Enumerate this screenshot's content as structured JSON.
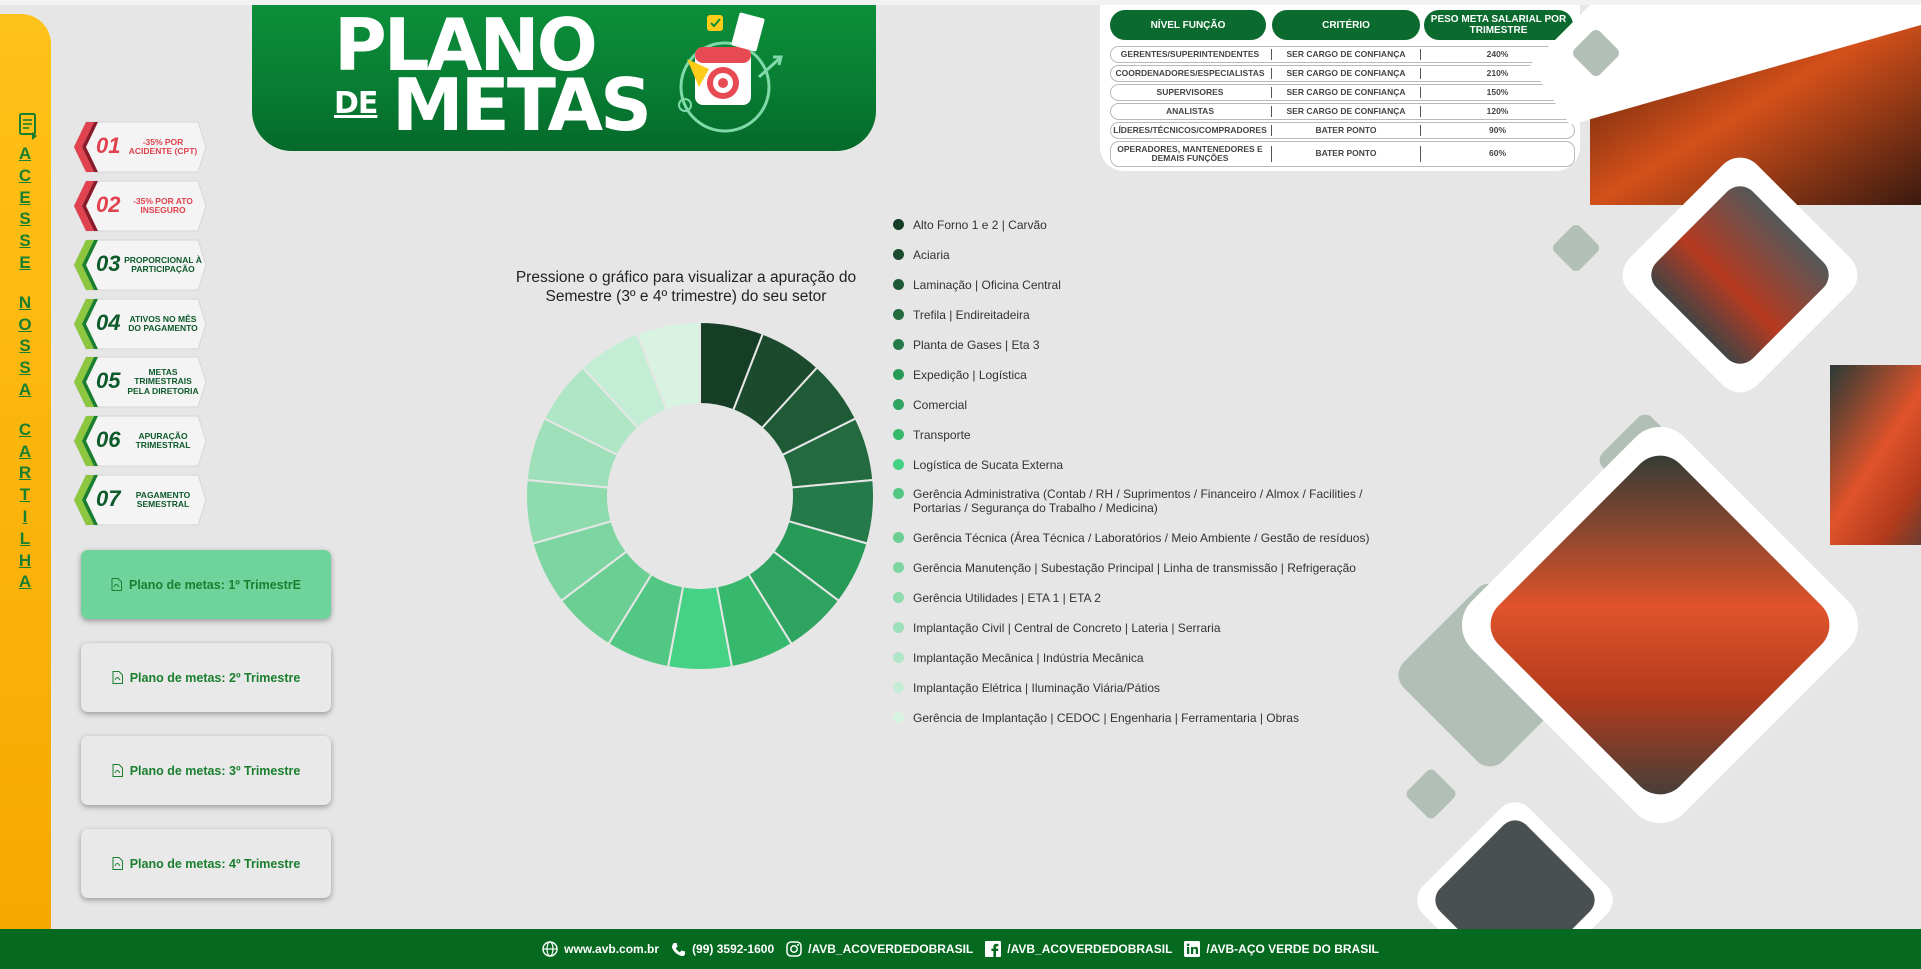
{
  "sidebar": {
    "vertical_link_letters": [
      "A",
      "C",
      "E",
      "S",
      "S",
      "E",
      "",
      "N",
      "O",
      "S",
      "S",
      "A",
      "",
      "C",
      "A",
      "R",
      "T",
      "I",
      "L",
      "H",
      "A"
    ]
  },
  "rules": [
    {
      "num": "01",
      "text": "-35% por acidente (CPT)",
      "color": "#e0424f"
    },
    {
      "num": "02",
      "text": "-35% por ato inseguro",
      "color": "#e0424f"
    },
    {
      "num": "03",
      "text": "Proporcional à participação",
      "color": "#0d5a2a"
    },
    {
      "num": "04",
      "text": "Ativos no mês do pagamento",
      "color": "#0d5a2a"
    },
    {
      "num": "05",
      "text": "Metas trimestrais pela diretoria",
      "color": "#0d5a2a"
    },
    {
      "num": "06",
      "text": "Apuração trimestral",
      "color": "#0d5a2a"
    },
    {
      "num": "07",
      "text": "Pagamento semestral",
      "color": "#0d5a2a"
    }
  ],
  "plan_buttons": [
    {
      "label": "Plano de metas: 1º TrimestrE",
      "active": true
    },
    {
      "label": "Plano de metas: 2º Trimestre",
      "active": false
    },
    {
      "label": "Plano de metas: 3º Trimestre",
      "active": false
    },
    {
      "label": "Plano de metas: 4º Trimestre",
      "active": false
    }
  ],
  "banner": {
    "line1": "PLANO",
    "line2_small": "DE",
    "line2": "METAS"
  },
  "table": {
    "headers": [
      "NÍVEL FUNÇÃO",
      "CRITÉRIO",
      "PESO META SALARIAL POR TRIMESTRE"
    ],
    "rows": [
      [
        "GERENTES/SUPERINTENDENTES",
        "SER CARGO DE CONFIANÇA",
        "240%"
      ],
      [
        "COORDENADORES/ESPECIALISTAS",
        "SER CARGO DE CONFIANÇA",
        "210%"
      ],
      [
        "SUPERVISORES",
        "SER CARGO DE CONFIANÇA",
        "150%"
      ],
      [
        "ANALISTAS",
        "SER CARGO DE CONFIANÇA",
        "120%"
      ],
      [
        "LÍDERES/TÉCNICOS/COMPRADORES",
        "BATER PONTO",
        "90%"
      ],
      [
        "OPERADORES, MANTENEDORES E DEMAIS FUNÇÕES",
        "BATER PONTO",
        "60%"
      ]
    ]
  },
  "chart": {
    "title": "Pressione o gráfico para visualizar a apuração do Semestre (3º e 4º trimestre) do seu setor"
  },
  "chart_data": {
    "type": "pie",
    "title": "Pressione o gráfico para visualizar a apuração do Semestre (3º e 4º trimestre) do seu setor",
    "categories": [
      "Alto Forno 1 e 2 | Carvão",
      "Aciaria",
      "Laminação | Oficina Central",
      "Trefila | Endireitadeira",
      "Planta de Gases | Eta 3",
      "Expedição | Logística",
      "Comercial",
      "Transporte",
      "Logística de Sucata Externa",
      "Gerência Administrativa (Contab / RH / Suprimentos / Financeiro / Almox / Facilities / Portarias / Segurança do Trabalho / Medicina)",
      "Gerência Técnica (Área Técnica / Laboratórios / Meio Ambiente / Gestão de resíduos)",
      "Gerência Manutenção | Subestação Principal | Linha de transmissão | Refrigeração",
      "Gerência Utilidades | ETA 1 | ETA 2",
      "Implantação Civil | Central de Concreto | Lateria | Serraria",
      "Implantação Mecânica | Indústria Mecânica",
      "Implantação Elétrica | Iluminação Viária/Pátios",
      "Gerência de Implantação | CEDOC | Engenharia | Ferramentaria | Obras"
    ],
    "values": [
      1,
      1,
      1,
      1,
      1,
      1,
      1,
      1,
      1,
      1,
      1,
      1,
      1,
      1,
      1,
      1,
      1
    ],
    "colors": [
      "#163d25",
      "#1b4a2d",
      "#1f5a36",
      "#236a3f",
      "#257a49",
      "#279a58",
      "#2fa461",
      "#37b96d",
      "#45d285",
      "#52c784",
      "#6bcf94",
      "#7dd6a2",
      "#8edbae",
      "#9ee0b9",
      "#afe6c5",
      "#c3edd4",
      "#d9f3e3"
    ],
    "legend_position": "right"
  },
  "footer": [
    {
      "icon": "globe-icon",
      "text": "www.avb.com.br"
    },
    {
      "icon": "phone-icon",
      "text": "(99) 3592-1600"
    },
    {
      "icon": "instagram-icon",
      "text": "/AVB_ACOVERDEDOBRASIL"
    },
    {
      "icon": "facebook-icon",
      "text": "/AVB_ACOVERDEDOBRASIL"
    },
    {
      "icon": "linkedin-icon",
      "text": "/AVB-AÇO VERDE DO BRASIL"
    }
  ],
  "colors": {
    "brand_green": "#0b6b2e",
    "accent_yellow": "#ffc21a",
    "footer_green": "#05691f",
    "active_button": "#6ed49c"
  }
}
